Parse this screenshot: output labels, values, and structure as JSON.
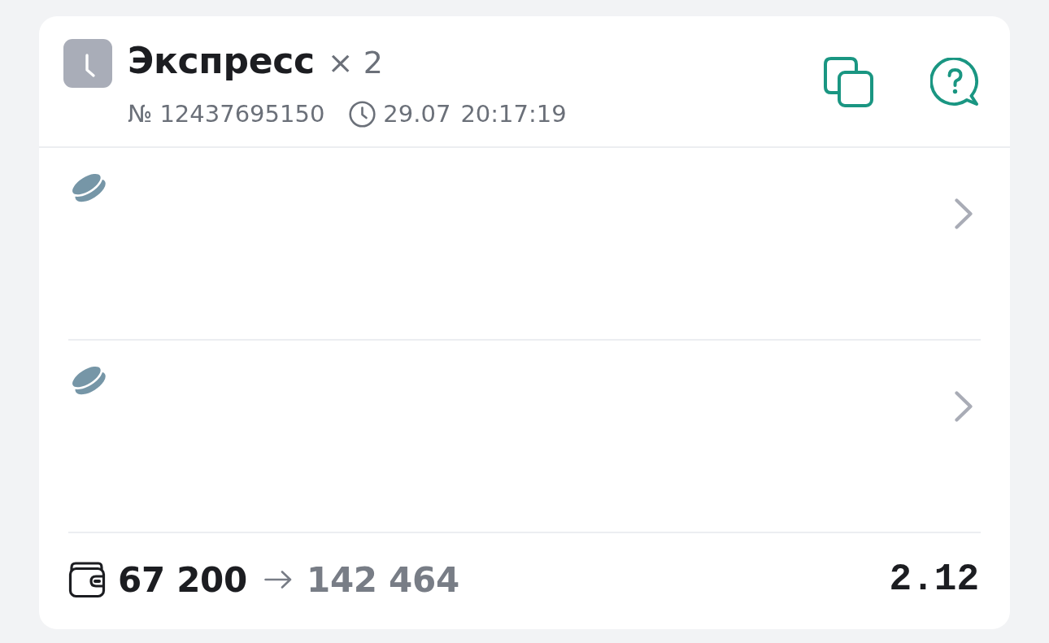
{
  "header": {
    "settled": false,
    "title": "Экспресс",
    "multiplier": "× 2",
    "number": "№ 12437695150",
    "date": "29.07",
    "time": "20:17:19"
  },
  "events": [
    {
      "kind": "hockey"
    },
    {
      "kind": "hockey"
    }
  ],
  "footer": {
    "stake": "67 200",
    "payout": "142 464",
    "odds": "2.12"
  }
}
